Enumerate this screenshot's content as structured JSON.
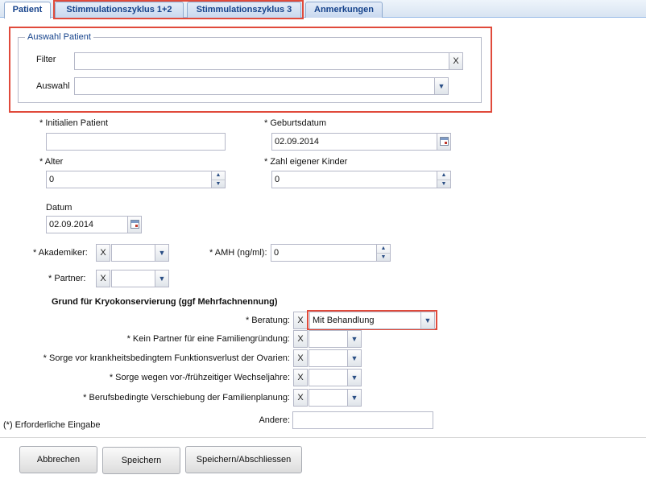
{
  "tabs": [
    {
      "label": "Patient",
      "active": true
    },
    {
      "label": "Stimmulationszyklus 1+2",
      "active": false
    },
    {
      "label": "Stimmulationszyklus 3",
      "active": false
    },
    {
      "label": "Anmerkungen",
      "active": false
    }
  ],
  "patient_select": {
    "legend": "Auswahl Patient",
    "filter_label": "Filter",
    "filter_value": "",
    "clear_label": "X",
    "auswahl_label": "Auswahl",
    "auswahl_value": ""
  },
  "form": {
    "initialen_label": "* Initialien Patient",
    "initialen_value": "",
    "geburtsdatum_label": "* Geburtsdatum",
    "geburtsdatum_value": "02.09.2014",
    "alter_label": "* Alter",
    "alter_value": "0",
    "kinder_label": "* Zahl eigener Kinder",
    "kinder_value": "0",
    "datum_label": "Datum",
    "datum_value": "02.09.2014",
    "akademiker_label": "* Akademiker:",
    "akademiker_value": "",
    "amh_label": "* AMH (ng/ml):",
    "amh_value": "0",
    "partner_label": "* Partner:",
    "partner_value": "",
    "clear_label": "X"
  },
  "grund": {
    "heading": "Grund für Kryokonservierung (ggf Mehrfachnennung)",
    "beratung_label": "* Beratung:",
    "beratung_value": "Mit Behandlung",
    "kein_partner_label": "* Kein Partner für eine Familiengründung:",
    "kein_partner_value": "",
    "sorge_funktion_label": "* Sorge vor krankheitsbedingtem Funktionsverlust der Ovarien:",
    "sorge_funktion_value": "",
    "sorge_wechsel_label": "* Sorge wegen vor-/frühzeitiger Wechseljahre:",
    "sorge_wechsel_value": "",
    "beruf_label": "* Berufsbedingte Verschiebung der Familienplanung:",
    "beruf_value": "",
    "andere_label": "Andere:",
    "andere_value": "",
    "clear_label": "X"
  },
  "required_note": "(*) Erforderliche Eingabe",
  "buttons": {
    "abbrechen": "Abbrechen",
    "speichern": "Speichern",
    "speichern_abschliessen": "Speichern/Abschliessen"
  },
  "icons": {
    "dropdown": "chevron-down-icon",
    "spinner": "spinner-arrows-icon",
    "calendar": "calendar-icon",
    "clear": "clear-x-icon"
  },
  "colors": {
    "tab_text": "#15428b",
    "highlight_border": "#e04a3b",
    "field_border": "#b5b8c8"
  }
}
